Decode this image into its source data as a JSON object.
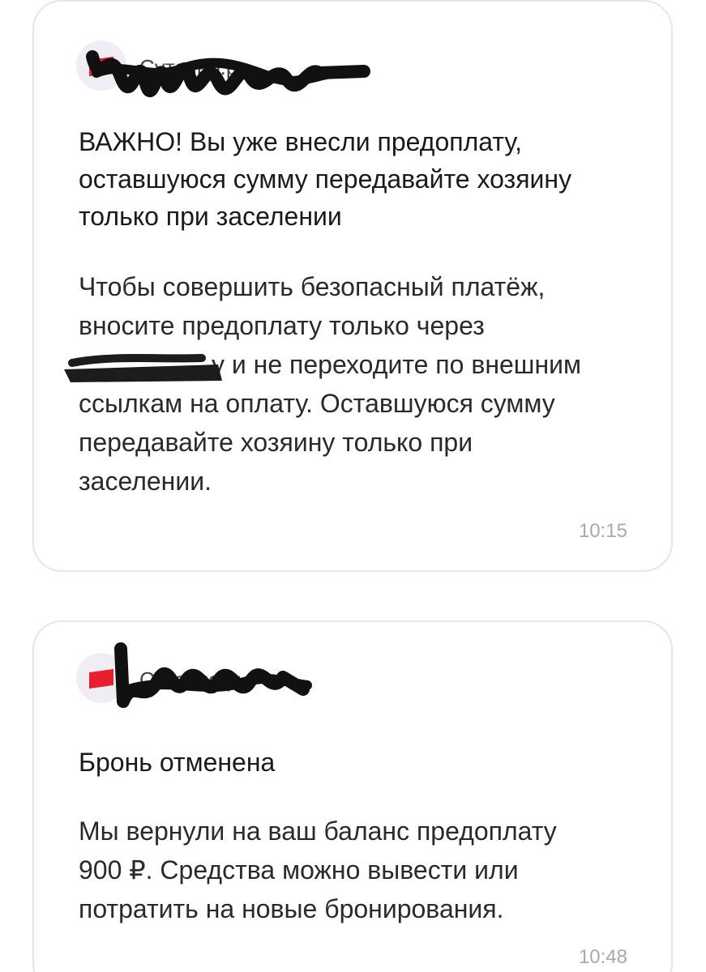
{
  "messages": [
    {
      "sender": "Суточно.ру",
      "title": "ВАЖНО! Вы уже внесли предоплату, оставшуюся сумму передавайте хозяину только при заселении",
      "title_lines": [
        "ВАЖНО! Вы уже внесли предоплату,",
        "оставшуюся сумму передавайте хозяину",
        "только при заселении"
      ],
      "body_lines": [
        "Чтобы совершить безопасный платёж,",
        "вносите предоплату только через",
        "у и не переходите по внешним",
        "ссылкам на оплату. Оставшуюся сумму",
        "передавайте хозяину только при",
        "заселении."
      ],
      "time": "10:15"
    },
    {
      "sender": "Суточно.ру",
      "title": "Бронь отменена",
      "body_lines": [
        "Мы вернули на ваш баланс предоплату",
        "900 ₽. Средства можно вывести или",
        "потратить на новые бронирования."
      ],
      "time": "10:48"
    }
  ],
  "colors": {
    "brand_red": "#e8202e",
    "avatar_bg": "#f0eef4",
    "card_border": "#e6e6e6",
    "time_text": "#a9a9a9"
  }
}
